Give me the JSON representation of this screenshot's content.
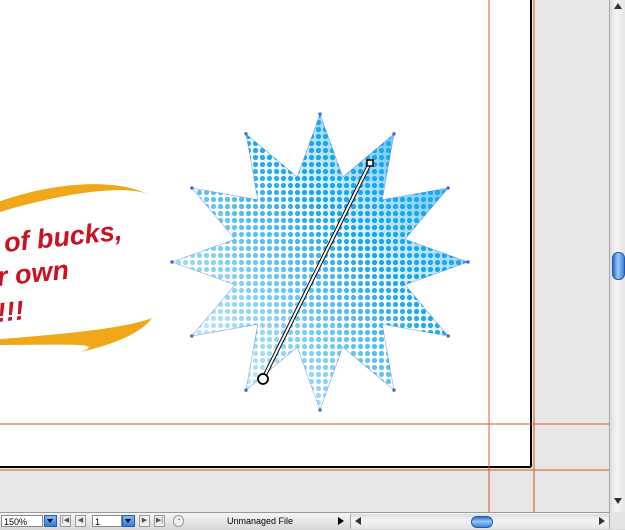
{
  "artwork": {
    "banner_lines": [
      "of bucks,",
      "r own",
      "!!!"
    ],
    "banner_text_color": "#cc1122",
    "swoosh_color": "#f0a818",
    "burst_color": "#19a8f0",
    "guide_color": "#e05a1a"
  },
  "status_bar": {
    "zoom_value": "150%",
    "page_value": "1",
    "status_text": "Unmanaged File"
  },
  "icons": {
    "first_page": "first-page-icon",
    "prev_page": "prev-page-icon",
    "next_page": "next-page-icon",
    "last_page": "last-page-icon",
    "version": "version-icon"
  }
}
